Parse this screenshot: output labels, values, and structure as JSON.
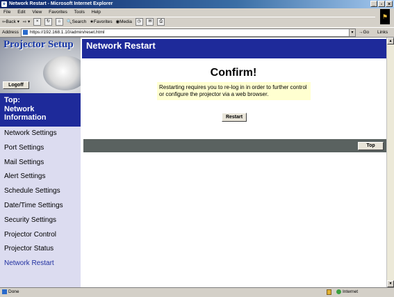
{
  "window": {
    "title": "Network Restart - Microsoft Internet Explorer"
  },
  "menu": [
    "File",
    "Edit",
    "View",
    "Favorites",
    "Tools",
    "Help"
  ],
  "toolbar": {
    "back": "Back",
    "search": "Search",
    "favorites": "Favorites",
    "media": "Media"
  },
  "address": {
    "label": "Address",
    "url": "https://192.168.1.10/admin/reset.html",
    "go": "Go",
    "links": "Links"
  },
  "sidebar": {
    "logo": "Projector Setup",
    "logoff": "Logoff",
    "top_section": [
      "Top:",
      "Network",
      "Information"
    ],
    "items": [
      "Network Settings",
      "Port Settings",
      "Mail Settings",
      "Alert Settings",
      "Schedule Settings",
      "Date/Time Settings",
      "Security Settings",
      "Projector Control",
      "Projector Status",
      "Network Restart"
    ],
    "active_index": 9
  },
  "main": {
    "header": "Network Restart",
    "heading": "Confirm!",
    "message": "Restarting requires you to re-log in in order to further control or configure the projector via a web browser.",
    "restart_button": "Restart",
    "top_button": "Top"
  },
  "status": {
    "text": "Done",
    "zone": "Internet"
  },
  "colors": {
    "nav_blue": "#1e2a9a",
    "message_bg": "#ffffd0",
    "bar_grey": "#5a6260",
    "sidebar_bg": "#dcdcf0"
  }
}
